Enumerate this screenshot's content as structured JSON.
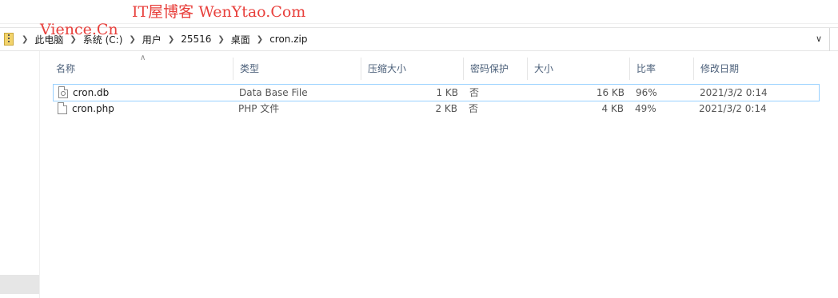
{
  "watermarks": {
    "line1": "IT屋博客 WenYtao.Com",
    "line2": "Vience.Cn"
  },
  "address": {
    "crumbs": [
      "此电脑",
      "系统 (C:)",
      "用户",
      "25516",
      "桌面",
      "cron.zip"
    ]
  },
  "columns": [
    "名称",
    "类型",
    "压缩大小",
    "密码保护",
    "大小",
    "比率",
    "修改日期"
  ],
  "files": [
    {
      "name": "cron.db",
      "type": "Data Base File",
      "packed": "1 KB",
      "protected": "否",
      "size": "16 KB",
      "ratio": "96%",
      "modified": "2021/3/2 0:14",
      "icon": "database-file-icon"
    },
    {
      "name": "cron.php",
      "type": "PHP 文件",
      "packed": "2 KB",
      "protected": "否",
      "size": "4 KB",
      "ratio": "49%",
      "modified": "2021/3/2 0:14",
      "icon": "file-icon"
    }
  ]
}
